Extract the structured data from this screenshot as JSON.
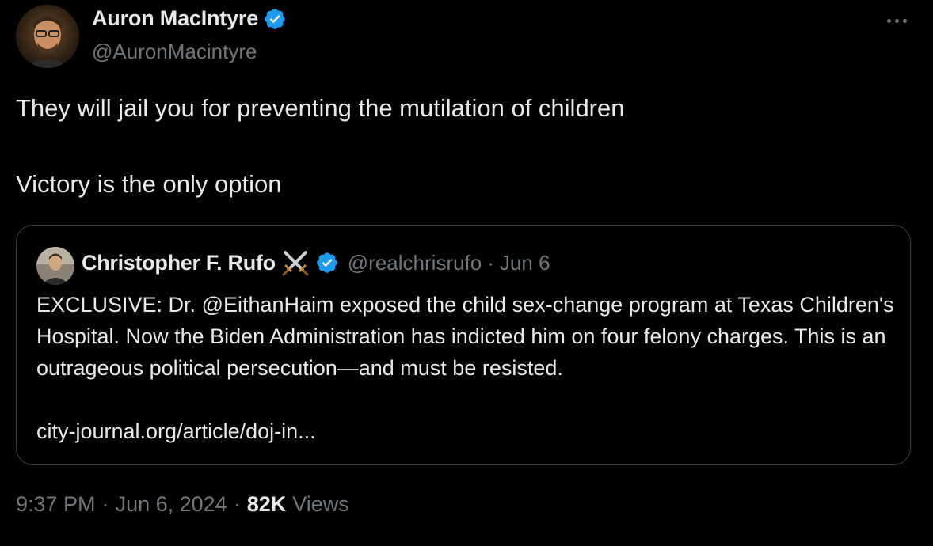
{
  "author": {
    "display_name": "Auron MacIntyre",
    "handle": "@AuronMacintyre",
    "verified": true
  },
  "tweet": {
    "line1": "They will jail you for preventing the mutilation of children",
    "line2": "Victory is the only option"
  },
  "quoted": {
    "display_name": "Christopher F. Rufo",
    "emoji": "crossed-swords-icon",
    "verified": true,
    "handle": "@realchrisrufo",
    "separator": "·",
    "date": "Jun 6",
    "text": "EXCLUSIVE: Dr. @EithanHaim exposed the child sex-change program at Texas Children's Hospital. Now the Biden Administration has indicted him on four felony charges. This is an outrageous political persecution—and must be resisted.",
    "link": "city-journal.org/article/doj-in..."
  },
  "meta": {
    "time": "9:37 PM",
    "sep1": "·",
    "date": "Jun 6, 2024",
    "sep2": "·",
    "views_count": "82K",
    "views_label": "Views"
  },
  "colors": {
    "background": "#000000",
    "text": "#e7e9ea",
    "secondary": "#71767b",
    "verified": "#1d9bf0",
    "border": "#3e4144"
  }
}
